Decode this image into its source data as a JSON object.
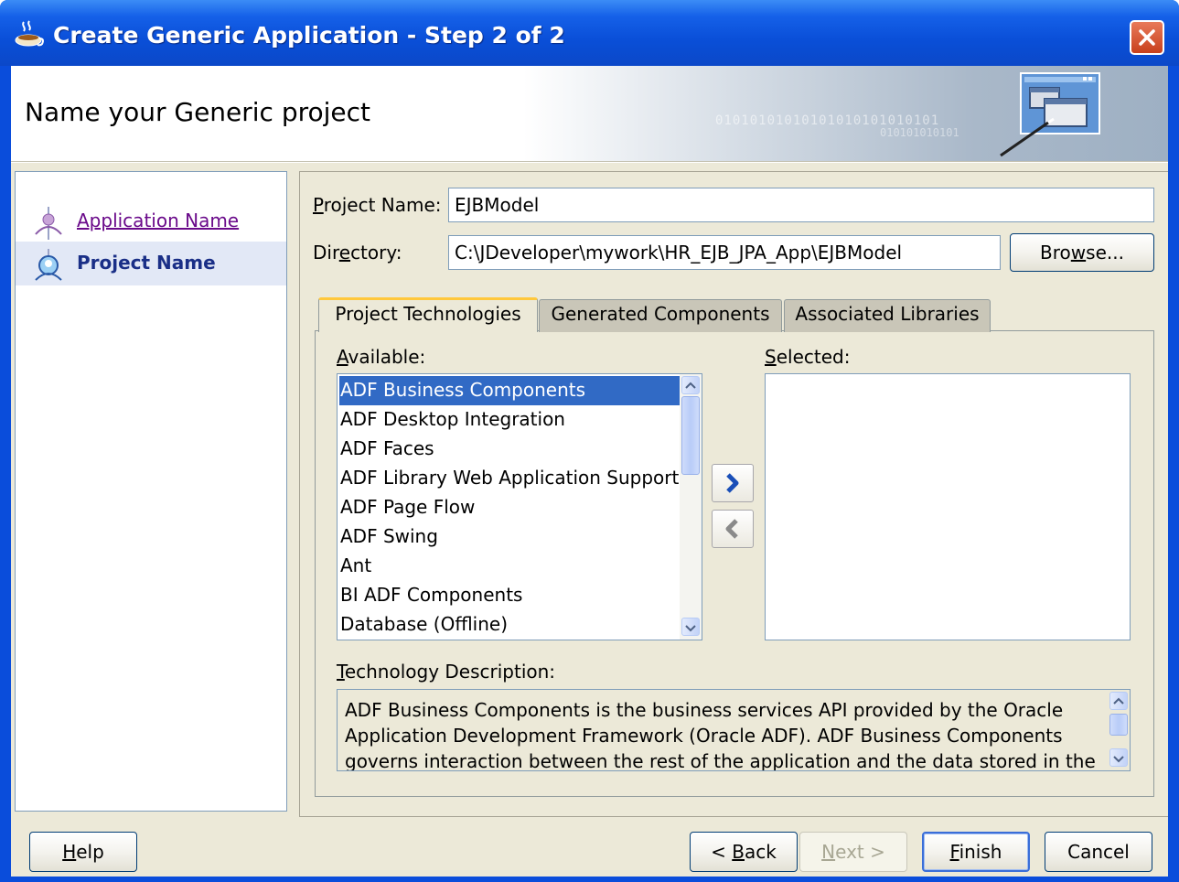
{
  "window": {
    "title": "Create Generic Application - Step 2 of 2"
  },
  "header": {
    "title": "Name your Generic project",
    "binary_line1": "01010101010101010101010101",
    "binary_line2": "010101010101"
  },
  "nav": {
    "items": [
      {
        "label": "Application Name",
        "state": "visited"
      },
      {
        "label": "Project Name",
        "state": "current"
      }
    ]
  },
  "form": {
    "project_name_label_m": "P",
    "project_name_label_rest": "roject Name:",
    "project_name_value": "EJBModel",
    "directory_label_a": "Dir",
    "directory_label_m": "e",
    "directory_label_b": "ctory:",
    "directory_value": "C:\\JDeveloper\\mywork\\HR_EJB_JPA_App\\EJBModel",
    "browse_a": "Bro",
    "browse_m": "w",
    "browse_b": "se..."
  },
  "tabs": [
    {
      "label": "Project Technologies",
      "active": true
    },
    {
      "label": "Generated Components",
      "active": false
    },
    {
      "label": "Associated Libraries",
      "active": false
    }
  ],
  "technologies": {
    "available_label_m": "A",
    "available_label_rest": "vailable:",
    "selected_label_m": "S",
    "selected_label_rest": "elected:",
    "available": [
      "ADF Business Components",
      "ADF Desktop Integration",
      "ADF Faces",
      "ADF Library Web Application Support",
      "ADF Page Flow",
      "ADF Swing",
      "Ant",
      "BI ADF Components",
      "Database (Offline)"
    ],
    "selected_index": 0,
    "selected": [],
    "description_label_m": "T",
    "description_label_rest": "echnology Description:",
    "description": "ADF Business Components is the business services API provided by the Oracle Application Development Framework (Oracle ADF).  ADF Business Components governs interaction between the rest of the application and the data stored in the"
  },
  "buttons": {
    "help_m": "H",
    "help_rest": "elp",
    "back_a": "< ",
    "back_m": "B",
    "back_rest": "ack",
    "next_m": "N",
    "next_rest": "ext >",
    "finish_m": "F",
    "finish_rest": "inish",
    "cancel": "Cancel"
  },
  "colors": {
    "titlebar": "#0a4fd8",
    "selection": "#316ac5",
    "visited_link": "#6a0a8a",
    "active_nav": "#1a2f87"
  },
  "icons": {
    "title": "coffee-cup-icon",
    "close": "close-icon",
    "wizard_graphic": "windows-wizard-graphic",
    "nav_visited": "person-node-icon",
    "nav_current": "magnifier-node-icon",
    "shuttle_add": "chevron-right-icon",
    "shuttle_remove": "chevron-left-icon"
  }
}
